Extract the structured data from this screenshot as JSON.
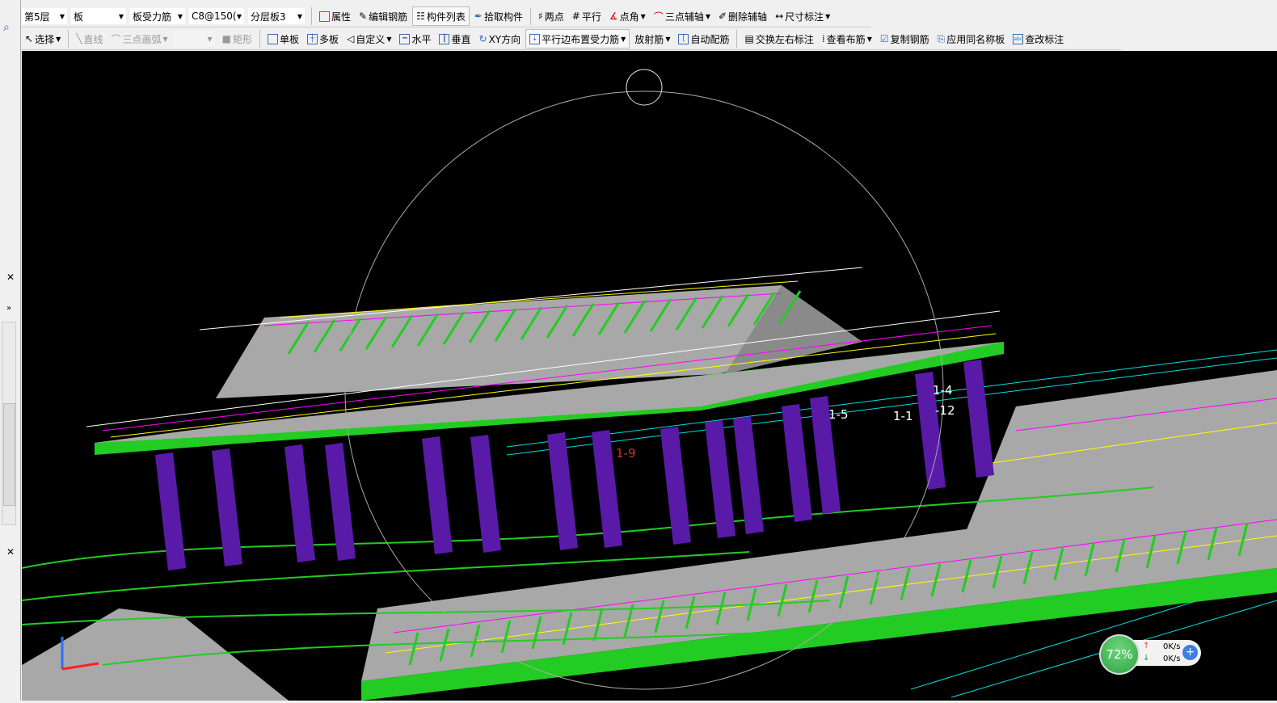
{
  "toolbar1": {
    "floor": "第5层",
    "type": "板",
    "rebar_type": "板受力筋",
    "rebar_spec": "C8@150(",
    "layer": "分层板3",
    "buttons": [
      "属性",
      "编辑钢筋",
      "构件列表",
      "拾取构件",
      "两点",
      "平行",
      "点角",
      "三点辅轴",
      "删除辅轴",
      "尺寸标注"
    ]
  },
  "toolbar2": {
    "buttons": [
      "选择",
      "直线",
      "三点画弧",
      "矩形",
      "单板",
      "多板",
      "自定义",
      "水平",
      "垂直",
      "XY方向",
      "平行边布置受力筋",
      "放射筋",
      "自动配筋",
      "交换左右标注",
      "查看布筋",
      "复制钢筋",
      "应用同名称板",
      "查改标注"
    ]
  },
  "scene": {
    "labels": [
      "1-4",
      "1-5",
      "1-1",
      "-12",
      "1-9"
    ],
    "colors": {
      "slab": "#a8a8a8",
      "edge": "#22cc22",
      "column": "#5a1aa8",
      "rebar1": "#ff00ff",
      "rebar2": "#ffff00",
      "axis": "#00e0e0"
    }
  },
  "net": {
    "percent": "72%",
    "up": "0K/s",
    "down": "0K/s"
  }
}
